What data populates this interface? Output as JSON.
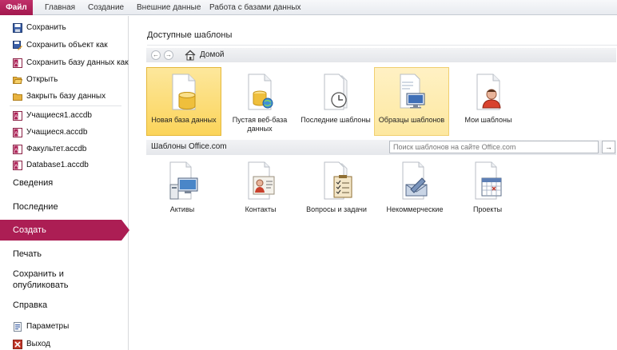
{
  "ribbon": {
    "file": "Файл",
    "tabs": [
      "Главная",
      "Создание",
      "Внешние данные",
      "Работа с базами данных"
    ]
  },
  "sidebar": {
    "save": "Сохранить",
    "save_object_as": "Сохранить объект как",
    "save_db_as": "Сохранить базу данных как",
    "open": "Открыть",
    "close_db": "Закрыть базу данных",
    "recent_files": [
      "Учащиеся1.accdb",
      "Учащиеся.accdb",
      "Факультет.accdb",
      "Database1.accdb"
    ],
    "info": "Сведения",
    "recent": "Последние",
    "create": "Создать",
    "print": "Печать",
    "save_publish": "Сохранить и опубликовать",
    "help": "Справка",
    "options": "Параметры",
    "exit": "Выход"
  },
  "main": {
    "section_title": "Доступные шаблоны",
    "nav_back": "←",
    "nav_forward": "→",
    "home": "Домой",
    "templates": [
      {
        "label": "Новая база данных",
        "icon": "database-doc-icon"
      },
      {
        "label": "Пустая веб-база данных",
        "icon": "web-database-icon"
      },
      {
        "label": "Последние шаблоны",
        "icon": "clock-doc-icon"
      },
      {
        "label": "Образцы шаблонов",
        "icon": "sample-templates-icon"
      },
      {
        "label": "Мои шаблоны",
        "icon": "user-doc-icon"
      }
    ],
    "office_title": "Шаблоны Office.com",
    "search_placeholder": "Поиск шаблонов на сайте Office.com",
    "search_go": "→",
    "office_templates": [
      {
        "label": "Активы",
        "icon": "assets-icon"
      },
      {
        "label": "Контакты",
        "icon": "contacts-icon"
      },
      {
        "label": "Вопросы и задачи",
        "icon": "tasks-icon"
      },
      {
        "label": "Некоммерческие",
        "icon": "nonprofit-icon"
      },
      {
        "label": "Проекты",
        "icon": "projects-icon"
      }
    ]
  },
  "colors": {
    "accent": "#ac1e54",
    "selected_tile": "#fbd45a"
  }
}
